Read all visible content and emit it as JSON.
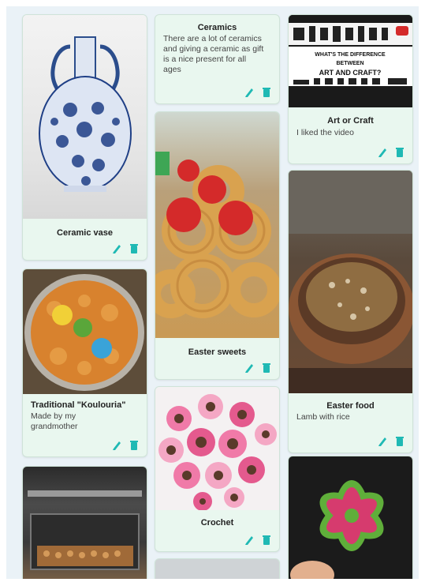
{
  "colors": {
    "card_bg": "#e9f7ef",
    "board_bg": "#eaf2f7",
    "action_icon": "#1fb9b4"
  },
  "cards": [
    {
      "title": "Ceramic vase",
      "description": "",
      "image": "blue-white-ceramic-vase"
    },
    {
      "title": "Traditional \"Koulouria\"",
      "description": "Made by my grandmother",
      "image": "koulouria-tray"
    },
    {
      "title": "",
      "description": "",
      "image": "oven-baking"
    },
    {
      "title": "Ceramics",
      "description": "There are a lot of ceramics and giving a ceramic as gift is a nice present for all ages",
      "image": ""
    },
    {
      "title": "Easter sweets",
      "description": "",
      "image": "easter-sweets-red-eggs"
    },
    {
      "title": "Crochet",
      "description": "",
      "image": "pink-crochet-flowers"
    },
    {
      "title": "Art or Craft",
      "description": "I liked the video",
      "image": "art-or-craft-video",
      "image_text": {
        "line1": "WHAT'S THE DIFFERENCE",
        "line2": "BETWEEN",
        "line3": "ART AND CRAFT?"
      }
    },
    {
      "title": "Easter food",
      "description": "Lamb with rice",
      "image": "lamb-with-rice-clay-pot"
    },
    {
      "title": "",
      "description": "",
      "image": "red-green-crochet-leaf"
    }
  ]
}
